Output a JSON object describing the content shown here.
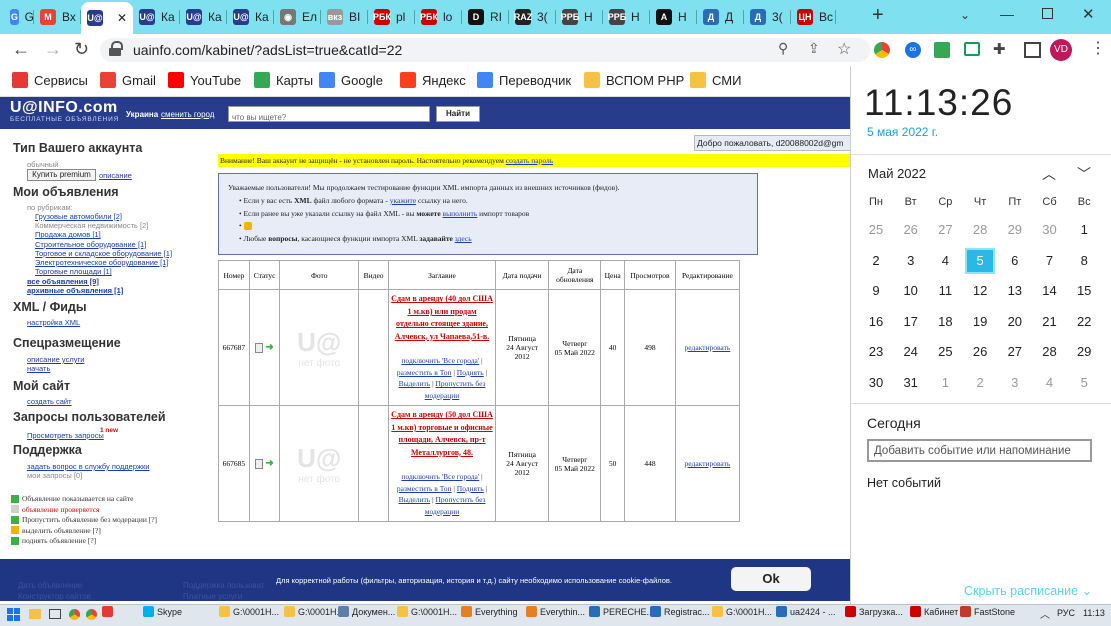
{
  "browser": {
    "tabs": [
      {
        "icon": "G",
        "color": "#4285f4",
        "label": "G"
      },
      {
        "icon": "M",
        "color": "#ea4335",
        "label": "Вх"
      },
      {
        "icon": "U@",
        "color": "#283c8c",
        "label": "",
        "active": true
      },
      {
        "icon": "U@",
        "color": "#283c8c",
        "label": "Ка"
      },
      {
        "icon": "U@",
        "color": "#283c8c",
        "label": "Ка"
      },
      {
        "icon": "U@",
        "color": "#283c8c",
        "label": "Ка"
      },
      {
        "icon": "◉",
        "color": "#777",
        "label": "Ел"
      },
      {
        "icon": "вкз",
        "color": "#999",
        "label": "ВІ"
      },
      {
        "icon": "РБК",
        "color": "#cc0000",
        "label": "рl"
      },
      {
        "icon": "РБК",
        "color": "#cc0000",
        "label": "lo"
      },
      {
        "icon": "D",
        "color": "#111",
        "label": "RI"
      },
      {
        "icon": "RAZ",
        "color": "#222",
        "label": "3("
      },
      {
        "icon": "РРБ",
        "color": "#444",
        "label": "Н"
      },
      {
        "icon": "РРБ",
        "color": "#444",
        "label": "Н"
      },
      {
        "icon": "A",
        "color": "#111",
        "label": "Н"
      },
      {
        "icon": "Д",
        "color": "#2a6bb6",
        "label": "Д"
      },
      {
        "icon": "Д",
        "color": "#2a6bb6",
        "label": "3("
      },
      {
        "icon": "ЦН",
        "color": "#c00",
        "label": "Вс"
      }
    ],
    "new_tab": "+",
    "url": "uainfo.com/kabinet/?adsList=true&catId=22",
    "bookmarks": [
      {
        "label": "Сервисы",
        "color": "#e53935"
      },
      {
        "label": "Gmail",
        "color": "#ea4335"
      },
      {
        "label": "YouTube",
        "color": "#ff0000"
      },
      {
        "label": "Карты",
        "color": "#34a853"
      },
      {
        "label": "Google",
        "color": "#4285f4"
      },
      {
        "label": "Яндекс",
        "color": "#fc3f1d"
      },
      {
        "label": "Переводчик",
        "color": "#4285f4"
      },
      {
        "label": "ВСПОМ PHP",
        "color": "#f6c244"
      },
      {
        "label": "СМИ",
        "color": "#f6c244"
      }
    ],
    "profile_initials": "VD"
  },
  "site": {
    "logo": "U@INFO.com",
    "logo_sub": "БЕСПЛАТНЫЕ ОБЪЯВЛЕНИЯ",
    "region": "Украина",
    "change_city": "сменить город",
    "search_placeholder": "что вы ищете?",
    "search_button": "Найти",
    "welcome": "Добро пожаловать, d20088002d@gm",
    "warning_prefix": "Внимание! Ваш аккаунт не защищён - не установлен пароль. Настоятельно рекомендуем ",
    "warning_link": "создать пароль",
    "notice": {
      "intro": "Уважаемые пользователи! Мы продолжаем тестирование функции XML импорта данных из внешних источников (фидов).",
      "b1a": "Если у вас есть ",
      "b1b": "XML",
      "b1c": " файл любого формата - ",
      "b1link": "укажите",
      "b1d": " ссылку на него.",
      "b2a": "Если ранее вы уже указали ссылку на файл XML - вы ",
      "b2b": "можете",
      "b2link": "выполнить",
      "b2c": " импорт товаров",
      "b4a": "Любые ",
      "b4b": "вопросы",
      "b4c": ", касающиеся функции импорта XML ",
      "b4d": "задавайте",
      "b4link": "здесь"
    },
    "sidebar": {
      "account_type_title": "Тип Вашего аккаунта",
      "account_type": "обычный",
      "buy_premium": "Купить premium",
      "description": "описание",
      "my_ads_title": "Мои объявления",
      "by_rubric": "по рубрикам:",
      "rubrics": [
        {
          "label": "Грузовые автомобили [2]",
          "link": true
        },
        {
          "label": "Коммерческая недвижимость [2]",
          "link": false
        },
        {
          "label": "Продажа домов [1]",
          "link": true
        },
        {
          "label": "Строительное оборудование [1]",
          "link": true
        },
        {
          "label": "Торговое и складское оборудование [1]",
          "link": true
        },
        {
          "label": "Электротехническое оборудование [1]",
          "link": true
        },
        {
          "label": "Торговые площади [1]",
          "link": true
        }
      ],
      "all_ads": "все объявления [9]",
      "archived_ads": "архивные объявления [1]",
      "xml_title": "XML / Фиды",
      "xml_settings": "настройка XML",
      "special_title": "Спецразмещение",
      "service_desc": "описание услуги",
      "start": "начать",
      "my_site_title": "Мой сайт",
      "create_site": "создать сайт",
      "requests_title": "Запросы пользователей",
      "view_requests": "Просмотреть запросы",
      "new_badge": "1 new",
      "support_title": "Поддержка",
      "ask_support": "задать вопрос в службу поддержки",
      "my_requests": "мои запросы [0]",
      "legend": [
        "Объявление показывается на сайте",
        "объявление проверяется",
        "Пропустить объявление без модерации [?]",
        "выделить объявление [?]",
        "поднять объявление [?]"
      ]
    },
    "table": {
      "headers": [
        "Номер",
        "Статус",
        "Фото",
        "Видео",
        "Заглавие",
        "Дата подачи",
        "Дата обновления",
        "Цена",
        "Просмотров",
        "Редактирование"
      ],
      "rows": [
        {
          "number": "667687",
          "title": "Сдам в аренду (40 дол США 1 м.кв) или продам отдельно стоящее здание, Алчевск, ул Чапаева,51-в.",
          "created_day": "Пятница",
          "created": "24 Август 2012",
          "updated_day": "Четверг",
          "updated": "05 Май 2022",
          "price": "40",
          "views": "498",
          "edit": "редактировать"
        },
        {
          "number": "667685",
          "title": "Сдам в аренду (50 дол США 1 м.кв) торговые и офисные площади, Алчевск, пр-т Металлургов, 48.",
          "created_day": "Пятница",
          "created": "24 Август 2012",
          "updated_day": "Четверг",
          "updated": "05 Май 2022",
          "price": "50",
          "views": "448",
          "edit": "редактировать"
        }
      ],
      "actions": {
        "connect": "подключить 'Все города'",
        "top": "разместить в Топ",
        "raise": "Поднять",
        "highlight": "Выделить",
        "skip": "Пропустить без модерации"
      },
      "photo_placeholder": "U@",
      "no_photo": "нет фото"
    },
    "cookie_text": "Для корректной работы (фильтры, авторизация, история и т.д.) сайту необходимо использование cookie-файлов.",
    "cookie_ok": "Ok",
    "footer_links": [
      "Дать объявление",
      "Конструктор сайтов",
      "Поддержка пользоват",
      "Платные услуги"
    ]
  },
  "calendar": {
    "time": "11:13:26",
    "date": "5 мая 2022 г.",
    "month": "Май 2022",
    "weekdays": [
      "Пн",
      "Вт",
      "Ср",
      "Чт",
      "Пт",
      "Сб",
      "Вс"
    ],
    "weeks": [
      [
        "25",
        "26",
        "27",
        "28",
        "29",
        "30",
        "1"
      ],
      [
        "2",
        "3",
        "4",
        "5",
        "6",
        "7",
        "8"
      ],
      [
        "9",
        "10",
        "11",
        "12",
        "13",
        "14",
        "15"
      ],
      [
        "16",
        "17",
        "18",
        "19",
        "20",
        "21",
        "22"
      ],
      [
        "23",
        "24",
        "25",
        "26",
        "27",
        "28",
        "29"
      ],
      [
        "30",
        "31",
        "1",
        "2",
        "3",
        "4",
        "5"
      ]
    ],
    "today_label": "Сегодня",
    "event_placeholder": "Добавить событие или напоминание",
    "no_events": "Нет событий",
    "hide_schedule": "Скрыть расписание"
  },
  "taskbar": {
    "items": [
      {
        "label": "",
        "color": "#e53935"
      },
      {
        "label": "Skype",
        "color": "#00aff0"
      },
      {
        "label": "G:\\0001Н...",
        "color": "#f6c244"
      },
      {
        "label": "G:\\0001Н...",
        "color": "#f6c244"
      },
      {
        "label": "Докумен...",
        "color": "#5b7fa6"
      },
      {
        "label": "G:\\0001Н...",
        "color": "#f6c244"
      },
      {
        "label": "Everything",
        "color": "#e67e22"
      },
      {
        "label": "Everythin...",
        "color": "#e67e22"
      },
      {
        "label": "PERECHE...",
        "color": "#2a6bb6"
      },
      {
        "label": "Registrac...",
        "color": "#2a6bb6"
      },
      {
        "label": "G:\\0001Н...",
        "color": "#f6c244"
      },
      {
        "label": "ua2424 - ...",
        "color": "#2a6bb6"
      },
      {
        "label": "Загрузка...",
        "color": "#cc0000"
      },
      {
        "label": "Кабинет ...",
        "color": "#cc0000"
      },
      {
        "label": "FastStone",
        "color": "#c0392b"
      }
    ],
    "lang": "РУС",
    "clock": "11:13"
  }
}
